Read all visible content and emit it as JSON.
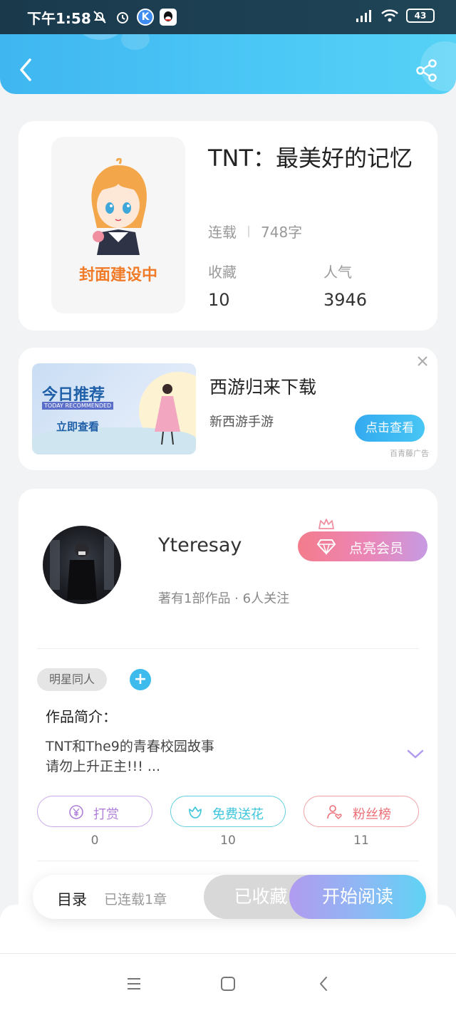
{
  "status_bar": {
    "time": "下午1:58",
    "battery": "43",
    "icons": [
      "bell-off-icon",
      "alarm-icon",
      "k-app-icon",
      "qq-icon",
      "signal-icon",
      "wifi-icon",
      "battery-icon"
    ]
  },
  "header": {
    "back_icon": "chevron-left-icon",
    "share_icon": "share-icon"
  },
  "book": {
    "cover_label": "封面建设中",
    "title": "TNT：最美好的记忆",
    "status": "连载",
    "word_count": "748字",
    "stats": [
      {
        "label": "收藏",
        "value": "10"
      },
      {
        "label": "人气",
        "value": "3946"
      }
    ]
  },
  "ad": {
    "banner_title": "今日推荐",
    "banner_subtitle": "TODAY RECOMMENDED",
    "banner_cta": "立即查看",
    "title": "西游归来下载",
    "subtitle": "新西游手游",
    "button": "点击查看",
    "source": "百青藤广告"
  },
  "author": {
    "name": "Yteresay",
    "meta": "著有1部作品 · 6人关注",
    "vip_button": "点亮会员",
    "tag": "明星同人",
    "intro_label": "作品简介：",
    "intro_line1": "TNT和The9的青春校园故事",
    "intro_line2": "请勿上升正主!!! ..."
  },
  "actions": [
    {
      "label": "打赏",
      "count": "0",
      "color": "#b07fd8"
    },
    {
      "label": "免费送花",
      "count": "10",
      "color": "#3cc5dc"
    },
    {
      "label": "粉丝榜",
      "count": "11",
      "color": "#ec6f78"
    }
  ],
  "bottom_bar": {
    "toc": "目录",
    "toc_status": "已连载1章",
    "collected": "已收藏",
    "read": "开始阅读"
  },
  "nav": [
    "menu-icon",
    "home-square-icon",
    "back-triangle-icon"
  ]
}
